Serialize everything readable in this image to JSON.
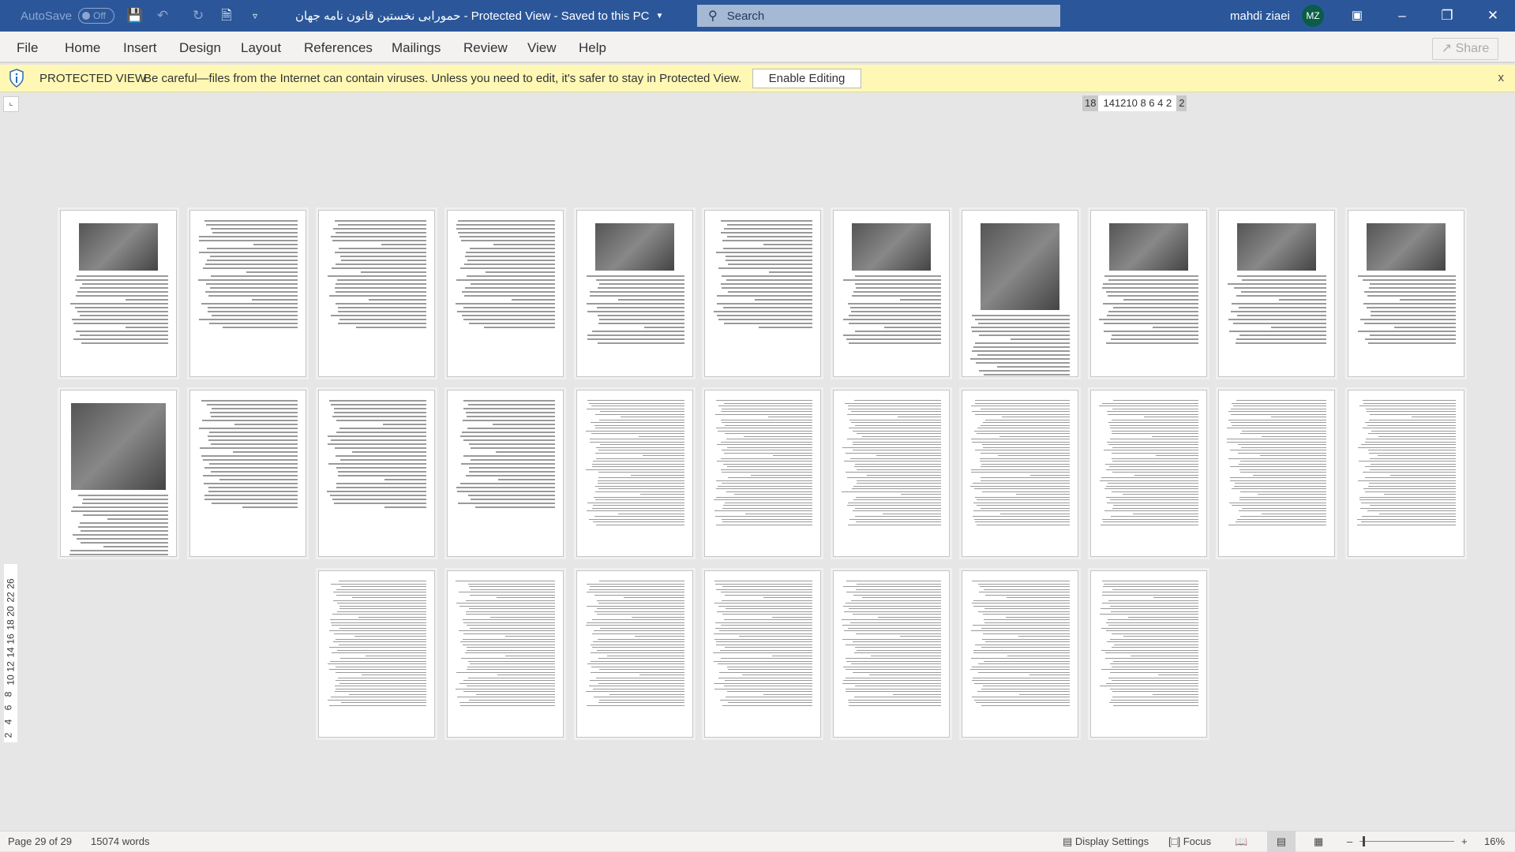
{
  "titlebar": {
    "autosave": "AutoSave",
    "autosave_state": "Off",
    "doc_title": "حمورابی نخستین قانون نامه جهان  -  Protected View  -  Saved to this PC",
    "search_placeholder": "Search",
    "user_name": "mahdi ziaei",
    "user_initials": "MZ"
  },
  "menu": {
    "items": [
      "File",
      "Home",
      "Insert",
      "Design",
      "Layout",
      "References",
      "Mailings",
      "Review",
      "View",
      "Help"
    ],
    "share": "Share"
  },
  "protected": {
    "title": "PROTECTED VIEW",
    "message": "Be careful—files from the Internet can contain viruses. Unless you need to edit, it's safer to stay in Protected View.",
    "enable_button": "Enable Editing",
    "close": "x"
  },
  "ruler": {
    "h_left": "18",
    "h_mid": "141210 8  6  4  2",
    "h_right": "2",
    "v_labels": [
      "2",
      "4",
      "6",
      "8",
      "10",
      "12",
      "14",
      "16",
      "18",
      "20",
      "22",
      "26"
    ]
  },
  "document": {
    "page_count": 29,
    "image_pages": [
      1,
      5,
      7,
      8,
      9,
      10,
      11,
      12
    ]
  },
  "status": {
    "page": "Page 29 of 29",
    "words": "15074 words",
    "display_settings": "Display Settings",
    "focus": "Focus",
    "zoom": "16%"
  }
}
